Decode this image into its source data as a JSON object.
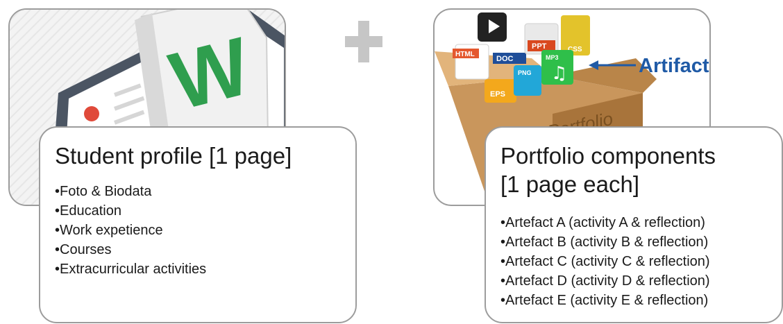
{
  "diagram": {
    "connector_icon": "plus-icon",
    "left_panel": {
      "image_icon": "word-document-profile-icon",
      "title": "Student profile [1 page]",
      "bullet_glyph": "•",
      "items": [
        "Foto & Biodata",
        "Education",
        "Work expetience",
        "Courses",
        "Extracurricular activities"
      ]
    },
    "right_panel": {
      "image_icon": "portfolio-box-icon",
      "image_labels": {
        "artifact": "Artifact",
        "box": "Portfolio",
        "files": [
          "HTML",
          "DOC",
          "PPT",
          "CSS",
          "EPS",
          "PNG",
          "MP3"
        ]
      },
      "title": "Portfolio components\n[1 page each]",
      "bullet_glyph": "•",
      "items": [
        "Artefact A (activity A & reflection)",
        "Artefact B (activity B & reflection)",
        "Artefact C (activity C & reflection)",
        "Artefact D (activity D & reflection)",
        "Artefact E (activity E & reflection)"
      ]
    },
    "colors": {
      "border": "#9c9c9c",
      "plus": "#c6c6c6",
      "word_green": "#2f9e4e",
      "user_red": "#e04a3a",
      "arrow_blue": "#1f5aa6",
      "box_brown": "#c9965c"
    }
  }
}
